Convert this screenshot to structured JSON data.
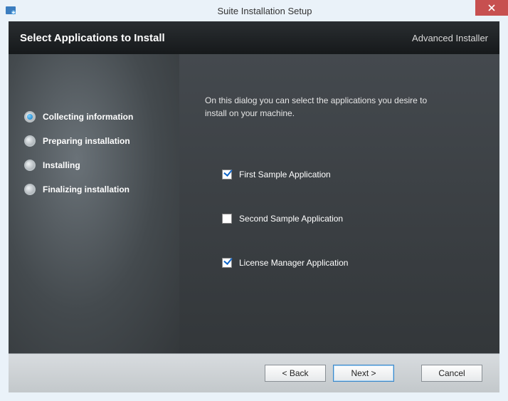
{
  "window": {
    "title": "Suite Installation Setup"
  },
  "header": {
    "page_title": "Select Applications to Install",
    "brand": "Advanced Installer"
  },
  "sidebar": {
    "steps": [
      {
        "label": "Collecting information",
        "active": true
      },
      {
        "label": "Preparing installation",
        "active": false
      },
      {
        "label": "Installing",
        "active": false
      },
      {
        "label": "Finalizing installation",
        "active": false
      }
    ]
  },
  "panel": {
    "instruction": "On this dialog you can select the applications you desire to install on your machine.",
    "apps": [
      {
        "label": "First Sample Application",
        "checked": true
      },
      {
        "label": "Second Sample Application",
        "checked": false
      },
      {
        "label": "License Manager Application",
        "checked": true
      }
    ]
  },
  "footer": {
    "back": "< Back",
    "next": "Next >",
    "cancel": "Cancel"
  }
}
